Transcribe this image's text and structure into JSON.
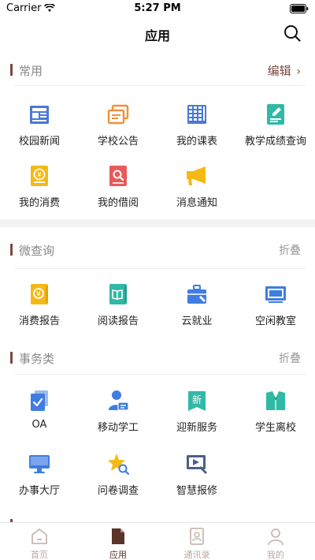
{
  "status_bar": {
    "carrier": "Carrier",
    "time": "5:27 PM"
  },
  "nav": {
    "title": "应用"
  },
  "sections": {
    "common": {
      "title": "常用",
      "action": "编辑",
      "items": [
        {
          "label": "校园新闻",
          "icon": "newspaper-icon",
          "color": "#4a78d6"
        },
        {
          "label": "学校公告",
          "icon": "notice-icon",
          "color": "#f0913a"
        },
        {
          "label": "我的课表",
          "icon": "schedule-grid-icon",
          "color": "#4a78d6"
        },
        {
          "label": "教学成绩查询",
          "icon": "grade-report-icon",
          "color": "#30b9a6"
        },
        {
          "label": "我的消费",
          "icon": "yuan-wallet-icon",
          "color": "#f5b914"
        },
        {
          "label": "我的借阅",
          "icon": "book-search-icon",
          "color": "#e85a5a"
        },
        {
          "label": "消息通知",
          "icon": "megaphone-icon",
          "color": "#f5b914"
        }
      ]
    },
    "micro": {
      "title": "微查询",
      "action": "折叠",
      "items": [
        {
          "label": "消费报告",
          "icon": "yuan-report-icon",
          "color": "#f5b914"
        },
        {
          "label": "阅读报告",
          "icon": "open-book-icon",
          "color": "#30b9a6"
        },
        {
          "label": "云就业",
          "icon": "briefcase-icon",
          "color": "#3f7de0"
        },
        {
          "label": "空闲教室",
          "icon": "classroom-screen-icon",
          "color": "#3f7de0"
        }
      ]
    },
    "affairs": {
      "title": "事务类",
      "action": "折叠",
      "items": [
        {
          "label": "OA",
          "icon": "oa-document-icon",
          "color": "#3f7de0"
        },
        {
          "label": "移动学工",
          "icon": "student-card-icon",
          "color": "#3f7de0"
        },
        {
          "label": "迎新服务",
          "icon": "welcome-banner-icon",
          "color": "#30b9a6"
        },
        {
          "label": "学生离校",
          "icon": "graduation-gown-icon",
          "color": "#30b9a6"
        },
        {
          "label": "办事大厅",
          "icon": "monitor-icon",
          "color": "#3f7de0"
        },
        {
          "label": "问卷调查",
          "icon": "star-search-icon",
          "color": "#f5b914"
        },
        {
          "label": "智慧报修",
          "icon": "repair-tools-icon",
          "color": "#4a5f8a"
        }
      ]
    }
  },
  "tab_bar": {
    "items": [
      {
        "label": "首页",
        "icon": "home-icon"
      },
      {
        "label": "应用",
        "icon": "apps-document-icon"
      },
      {
        "label": "通讯录",
        "icon": "contacts-icon"
      },
      {
        "label": "我的",
        "icon": "profile-icon"
      }
    ],
    "active_index": 1
  },
  "colors": {
    "accent": "#7a4a3c",
    "active_tab": "#5a3428",
    "inactive_tab": "#b9a9a3"
  }
}
